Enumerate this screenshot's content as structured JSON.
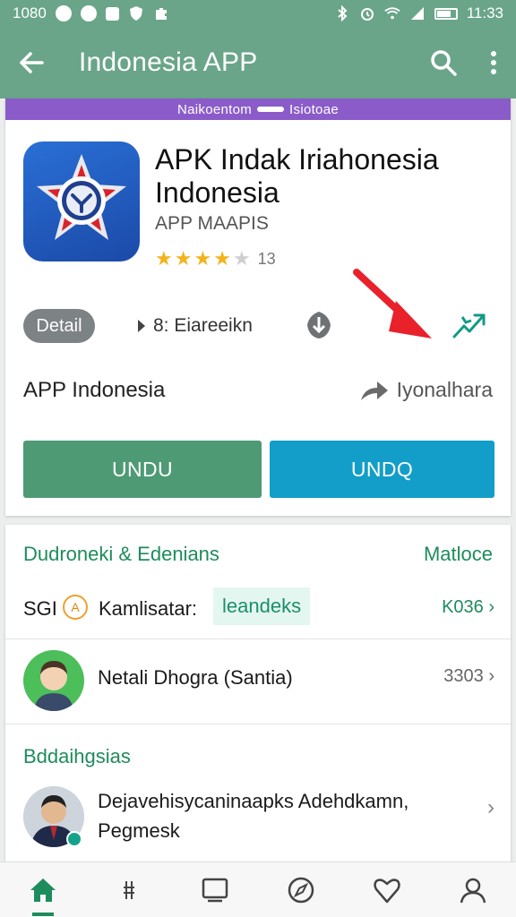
{
  "status_bar": {
    "left_time": "1080",
    "right_time": "11:33"
  },
  "app_bar": {
    "title": "Indonesia APP",
    "back_icon": "arrow-left-icon",
    "search_icon": "search-icon",
    "menu_icon": "more-vert-icon"
  },
  "banner": {
    "left_text": "Naikoentom",
    "right_text": "Isiotoae"
  },
  "app": {
    "title": "APK Indak Iriahonesia Indonesia",
    "subtitle": "APP MAAPIS",
    "rating_value": 4,
    "rating_count": "13",
    "detail_chip": "Detail",
    "play_text": "8: Eiareeikn",
    "name_row": "APP Indonesia",
    "developer": "Iyonalhara",
    "btn_left": "UNDU",
    "btn_right": "UNDQ",
    "colors": {
      "primary": "#6aa58a",
      "purple": "#8b5cc9",
      "green_btn": "#4e9a75",
      "blue_btn": "#129ec8",
      "arrow": "#e8212b"
    }
  },
  "section1": {
    "heading": "Dudroneki & Edenians",
    "more": "Matloce",
    "row1": {
      "lead": "SGI",
      "badge": "A",
      "name": "Kamlisatar:",
      "tag": "leandeks",
      "count": "K036"
    },
    "row2": {
      "name": "Netali Dhogra (Santia)",
      "count": "3303"
    }
  },
  "section2": {
    "heading": "Bddaihgsias",
    "row": {
      "text": "Dejavehisycaninaapks Adehdkamn, Pegmesk"
    }
  },
  "bottom_nav": [
    {
      "icon": "home-icon",
      "active": true
    },
    {
      "icon": "signal-icon",
      "active": false
    },
    {
      "icon": "apps-icon",
      "active": false
    },
    {
      "icon": "compass-icon",
      "active": false
    },
    {
      "icon": "heart-icon",
      "active": false
    },
    {
      "icon": "person-icon",
      "active": false
    }
  ]
}
